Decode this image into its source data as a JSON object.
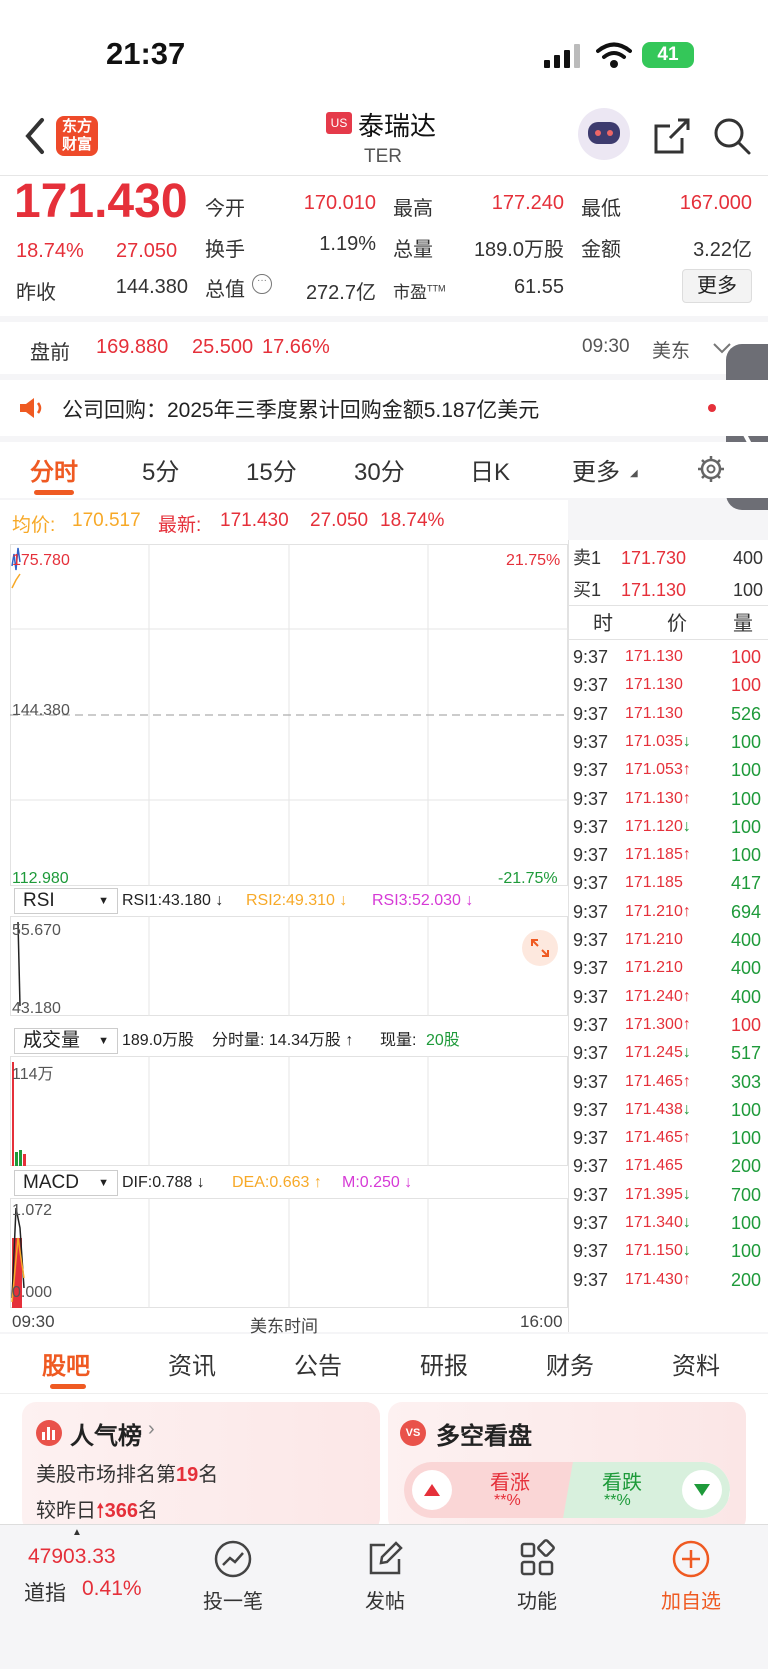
{
  "status_bar": {
    "time": "21:37",
    "battery": "41"
  },
  "header": {
    "logo_text": "东方财富",
    "market_badge": "US",
    "stock_name": "泰瑞达",
    "stock_code": "TER"
  },
  "quote": {
    "price": "171.430",
    "change_pct": "18.74%",
    "change_amt": "27.050",
    "prev_close_label": "昨收",
    "prev_close": "144.380",
    "open_label": "今开",
    "open": "170.010",
    "high_label": "最高",
    "high": "177.240",
    "low_label": "最低",
    "low": "167.000",
    "turnover_label": "换手",
    "turnover": "1.19%",
    "volume_label": "总量",
    "volume": "189.0万股",
    "amount_label": "金额",
    "amount": "3.22亿",
    "mktcap_label": "总值",
    "mktcap": "272.7亿",
    "pe_label": "市盈",
    "pe_sup": "TTM",
    "pe": "61.55",
    "more_button": "更多"
  },
  "premarket": {
    "label": "盘前",
    "price": "169.880",
    "change": "25.500",
    "pct": "17.66%",
    "time": "09:30",
    "tz": "美东"
  },
  "notice": {
    "text": "公司回购：2025年三季度累计回购金额5.187亿美元"
  },
  "chart_tabs": [
    "分时",
    "5分",
    "15分",
    "30分",
    "日K",
    "更多"
  ],
  "avg_line": {
    "avg_label": "均价:",
    "avg": "170.517",
    "latest_label": "最新:",
    "latest": "171.430",
    "chg": "27.050",
    "pct": "18.74%"
  },
  "intraday": {
    "top_price": "175.780",
    "top_pct": "21.75%",
    "mid_price": "144.380",
    "bottom_price": "112.980",
    "bottom_pct": "-21.75%"
  },
  "rsi": {
    "selector": "RSI",
    "rsi1": "RSI1:43.180 ↓",
    "rsi2": "RSI2:49.310 ↓",
    "rsi3": "RSI3:52.030 ↓",
    "top": "55.670",
    "bottom": "43.180"
  },
  "volume_ind": {
    "selector": "成交量",
    "total": "189.0万股",
    "period_label": "分时量: 14.34万股 ↑",
    "current_label": "现量:",
    "current": "20股",
    "top": "114万"
  },
  "macd": {
    "selector": "MACD",
    "dif": "DIF:0.788 ↓",
    "dea": "DEA:0.663 ↑",
    "m": "M:0.250 ↓",
    "top": "1.072",
    "bottom": "0.000"
  },
  "time_axis": {
    "start": "09:30",
    "mid": "美东时间",
    "end": "16:00"
  },
  "orderbook": {
    "ask_label": "卖1",
    "ask_price": "171.730",
    "ask_vol": "400",
    "bid_label": "买1",
    "bid_price": "171.130",
    "bid_vol": "100"
  },
  "trades_header": {
    "time": "时",
    "price": "价",
    "vol": "量"
  },
  "trades": [
    {
      "t": "9:37",
      "p": "171.130",
      "d": "",
      "v": "100",
      "vc": "red"
    },
    {
      "t": "9:37",
      "p": "171.130",
      "d": "",
      "v": "100",
      "vc": "red"
    },
    {
      "t": "9:37",
      "p": "171.130",
      "d": "",
      "v": "526",
      "vc": "green"
    },
    {
      "t": "9:37",
      "p": "171.035",
      "d": "↓",
      "v": "100",
      "vc": "green"
    },
    {
      "t": "9:37",
      "p": "171.053",
      "d": "↑",
      "v": "100",
      "vc": "green"
    },
    {
      "t": "9:37",
      "p": "171.130",
      "d": "↑",
      "v": "100",
      "vc": "green"
    },
    {
      "t": "9:37",
      "p": "171.120",
      "d": "↓",
      "v": "100",
      "vc": "green"
    },
    {
      "t": "9:37",
      "p": "171.185",
      "d": "↑",
      "v": "100",
      "vc": "green"
    },
    {
      "t": "9:37",
      "p": "171.185",
      "d": "",
      "v": "417",
      "vc": "green"
    },
    {
      "t": "9:37",
      "p": "171.210",
      "d": "↑",
      "v": "694",
      "vc": "green"
    },
    {
      "t": "9:37",
      "p": "171.210",
      "d": "",
      "v": "400",
      "vc": "green"
    },
    {
      "t": "9:37",
      "p": "171.210",
      "d": "",
      "v": "400",
      "vc": "green"
    },
    {
      "t": "9:37",
      "p": "171.240",
      "d": "↑",
      "v": "400",
      "vc": "green"
    },
    {
      "t": "9:37",
      "p": "171.300",
      "d": "↑",
      "v": "100",
      "vc": "red"
    },
    {
      "t": "9:37",
      "p": "171.245",
      "d": "↓",
      "v": "517",
      "vc": "green"
    },
    {
      "t": "9:37",
      "p": "171.465",
      "d": "↑",
      "v": "303",
      "vc": "green"
    },
    {
      "t": "9:37",
      "p": "171.438",
      "d": "↓",
      "v": "100",
      "vc": "green"
    },
    {
      "t": "9:37",
      "p": "171.465",
      "d": "↑",
      "v": "100",
      "vc": "green"
    },
    {
      "t": "9:37",
      "p": "171.465",
      "d": "",
      "v": "200",
      "vc": "green"
    },
    {
      "t": "9:37",
      "p": "171.395",
      "d": "↓",
      "v": "700",
      "vc": "green"
    },
    {
      "t": "9:37",
      "p": "171.340",
      "d": "↓",
      "v": "100",
      "vc": "green"
    },
    {
      "t": "9:37",
      "p": "171.150",
      "d": "↓",
      "v": "100",
      "vc": "green"
    },
    {
      "t": "9:37",
      "p": "171.430",
      "d": "↑",
      "v": "200",
      "vc": "green"
    }
  ],
  "bottom_tabs": [
    "股吧",
    "资讯",
    "公告",
    "研报",
    "财务",
    "资料"
  ],
  "popularity": {
    "title": "人气榜",
    "rank_prefix": "美股市场排名第",
    "rank": "19",
    "rank_suffix": "名",
    "compare_prefix": "较昨日",
    "compare": "366",
    "compare_suffix": "名"
  },
  "bull_bear": {
    "title": "多空看盘",
    "bull_label": "看涨",
    "bull_pct": "**%",
    "bear_label": "看跌",
    "bear_pct": "**%"
  },
  "nav": {
    "index_value": "47903.33",
    "index_name": "道指",
    "index_pct": "0.41%",
    "items": [
      "投一笔",
      "发帖",
      "功能",
      "加自选"
    ]
  }
}
